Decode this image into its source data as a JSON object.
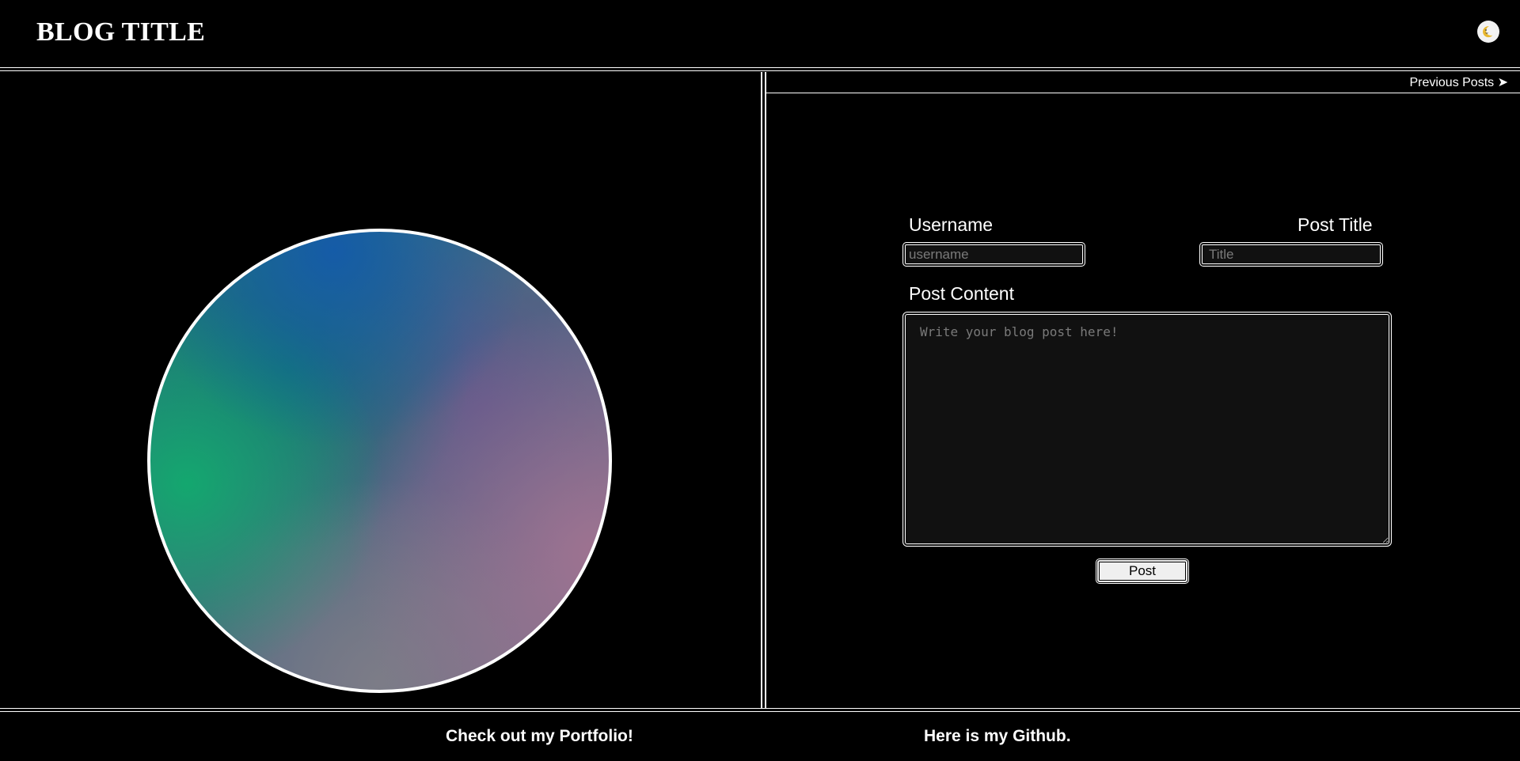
{
  "header": {
    "title": "BLOG TITLE",
    "theme_toggle_icon": "moon-icon"
  },
  "nav": {
    "previous_posts": "Previous Posts ➤"
  },
  "form": {
    "username_label": "Username",
    "username_placeholder": "username",
    "username_value": "",
    "title_label": "Post Title",
    "title_placeholder": "Title",
    "title_value": "",
    "content_label": "Post Content",
    "content_placeholder": "Write your blog post here!",
    "content_value": "",
    "submit_label": "Post"
  },
  "footer": {
    "portfolio_link": "Check out my Portfolio!",
    "github_link": "Here is my Github."
  },
  "colors": {
    "background": "#000000",
    "foreground": "#ffffff",
    "input_background": "#111111",
    "placeholder": "#7a7a7a",
    "button_background": "#efefef"
  }
}
